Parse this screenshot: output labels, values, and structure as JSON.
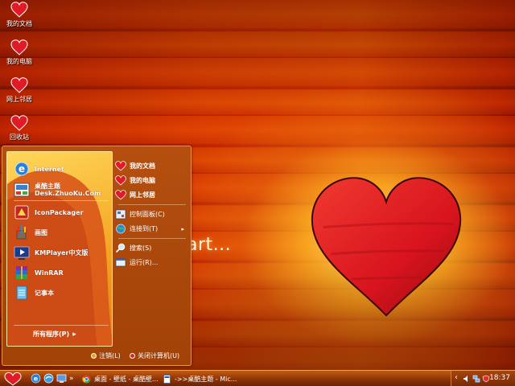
{
  "desktop": {
    "icons": [
      {
        "label": "我的文档"
      },
      {
        "label": "我的电脑"
      },
      {
        "label": "网上邻居"
      },
      {
        "label": "回收站"
      }
    ],
    "wallpaper_text": "art..."
  },
  "start_menu": {
    "pinned": [
      {
        "label": "Internet"
      },
      {
        "label": "桌酷主题",
        "sub": "Desk.ZhuoKu.Com"
      }
    ],
    "recent": [
      {
        "label": "IconPackager"
      },
      {
        "label": "画图"
      },
      {
        "label": "KMPlayer中文版"
      },
      {
        "label": "WinRAR"
      },
      {
        "label": "记事本"
      }
    ],
    "all_programs_label": "所有程序(P)",
    "all_programs_arrow": "▸",
    "right_items": [
      {
        "label": "我的文档"
      },
      {
        "label": "我的电脑"
      },
      {
        "label": "网上邻居"
      },
      {
        "label": "控制面板(C)"
      },
      {
        "label": "连接到(T)",
        "chevron": "▸"
      },
      {
        "label": "搜索(S)"
      },
      {
        "label": "运行(R)..."
      }
    ],
    "footer": {
      "logoff_label": "注销(L)",
      "shutdown_label": "关闭计算机(U)"
    }
  },
  "taskbar": {
    "tasks": [
      {
        "label": "桌面 - 壁纸 - 桌酷壁..."
      },
      {
        "label": "->>桌酷主题 - Mic..."
      }
    ],
    "quicklaunch_chevron": "»",
    "tray_chevron": "‹",
    "clock": "18:37"
  },
  "colors": {
    "heart_red": "#d8141e",
    "menu_orange": "#b44f0f",
    "panel_yellow": "#f5a825",
    "taskbar": "#8e3406"
  }
}
